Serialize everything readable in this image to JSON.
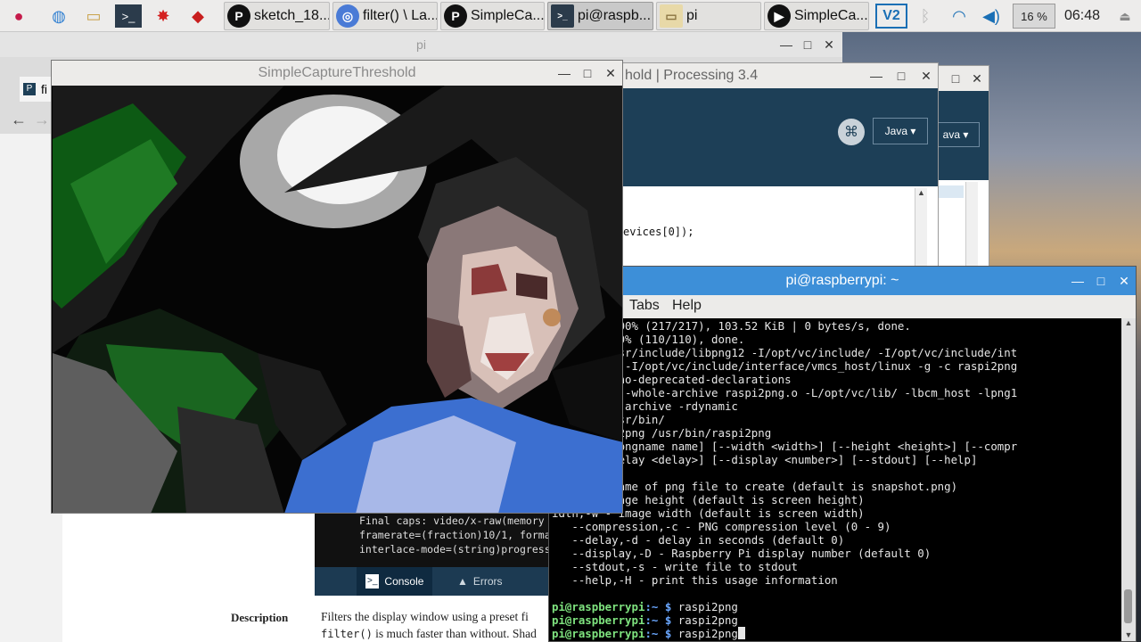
{
  "taskbar": {
    "tasks": [
      {
        "label": "sketch_18..."
      },
      {
        "label": "filter() \\ La..."
      },
      {
        "label": "SimpleCa..."
      },
      {
        "label": "pi@raspb..."
      },
      {
        "label": "pi"
      },
      {
        "label": "SimpleCa..."
      }
    ],
    "cpu": "16 %",
    "clock": "06:48"
  },
  "browser": {
    "tab_title": "fi",
    "title": "pi"
  },
  "processing_window": {
    "title": "hold | Processing 3.4",
    "mode": "Java ▾",
    "mode_back": "ava ▾",
    "code_line": "evices[0]);"
  },
  "terminal": {
    "title": "pi@raspberrypi: ~",
    "menu": [
      "Tabs",
      "Help"
    ],
    "lines": [
      "objects: 100% (217/217), 103.52 KiB | 0 bytes/s, done.",
      "deltas: 100% (110/110), done.",
      "g -O3 -I/usr/include/libpng12 -I/opt/vc/include/ -I/opt/vc/include/int",
      "s/pthreads -I/opt/vc/include/interface/vmcs_host/linux -g -c raspi2png",
      "i2png.o -Wno-deprecated-declarations",
      "i2png -Wl,--whole-archive raspi2png.o -L/opt/vc/lib/ -lbcm_host -lpng1",
      "--no-whole-archive -rdynamic",
      " -m 755 /usr/bin/",
      " 755 raspi2png /usr/bin/raspi2png",
      "pi2png [--pngname name] [--width <width>] [--height <height>] [--compr",
      "vel>] [--delay <delay>] [--display <number>] [--stdout] [--help]",
      "",
      "ame,-p - name of png file to create (default is snapshot.png)",
      "ht,-h - image height (default is screen height)",
      "idth,-w - image width (default is screen width)",
      "   --compression,-c - PNG compression level (0 - 9)",
      "   --delay,-d - delay in seconds (default 0)",
      "   --display,-D - Raspberry Pi display number (default 0)",
      "   --stdout,-s - write file to stdout",
      "   --help,-H - print this usage information",
      ""
    ],
    "prompts": [
      {
        "user": "pi@raspberrypi",
        "dir": ":~ $ ",
        "cmd": "raspi2png"
      },
      {
        "user": "pi@raspberrypi",
        "dir": ":~ $ ",
        "cmd": "raspi2png"
      },
      {
        "user": "pi@raspberrypi",
        "dir": ":~ $ ",
        "cmd": "raspi2png"
      }
    ]
  },
  "capture_window": {
    "title": "SimpleCaptureThreshold"
  },
  "console": {
    "lines": [
      "Final caps: video/x-raw(memory",
      "framerate=(fraction)10/1, forma",
      "interlace-mode=(string)progress"
    ],
    "tab_console": "Console",
    "tab_errors": "Errors"
  },
  "reference": {
    "description_label": "Description",
    "line1": "Filters the display window using a preset fi",
    "line2_code": "filter()",
    "line2_text": " is much faster than without. Shad"
  }
}
